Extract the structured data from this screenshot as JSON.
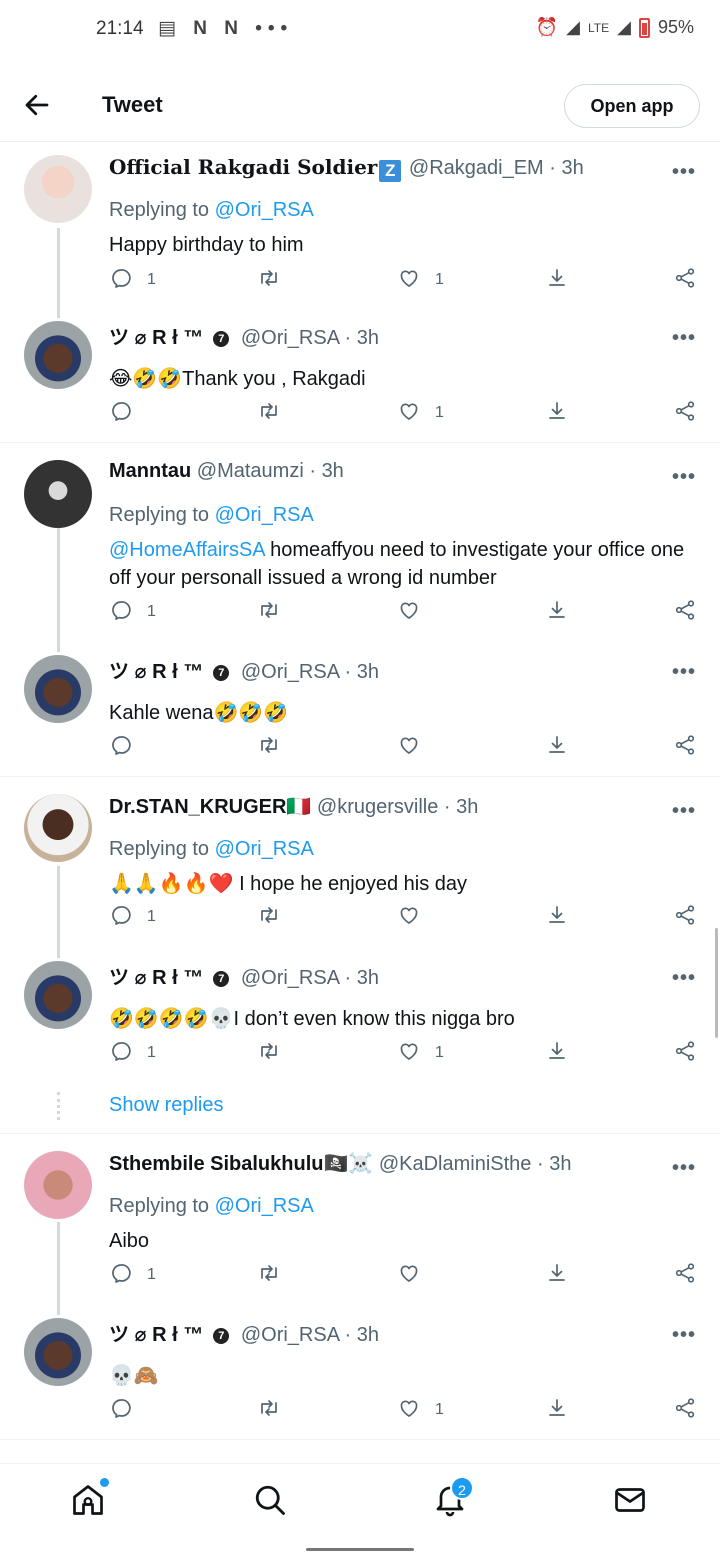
{
  "status_bar": {
    "time": "21:14",
    "notif_icons": "N N",
    "more": "•••",
    "network": "LTE",
    "battery": "95%"
  },
  "header": {
    "title": "Tweet",
    "open_app": "Open app"
  },
  "replying_label": "Replying to",
  "tweets": [
    {
      "name": "Official Rakgadi Soldier",
      "badge": "Z",
      "handle": "@Rakgadi_EM",
      "time": "3h",
      "replying_to": "@Ori_RSA",
      "text": "Happy birthday to him",
      "replies": "1",
      "retweets": "",
      "likes": "1"
    },
    {
      "name": "ツ ⌀ R ł ™",
      "badge": "7",
      "handle": "@Ori_RSA",
      "time": "3h",
      "replying_to": "",
      "text": "😂🤣🤣Thank you , Rakgadi",
      "replies": "",
      "retweets": "",
      "likes": "1"
    },
    {
      "name": "Manntau",
      "badge": "",
      "handle": "@Mataumzi",
      "time": "3h",
      "replying_to": "@Ori_RSA",
      "mention": "@HomeAffairsSA",
      "text": " homeaffyou need to investigate your office one off your personall issued a wrong id number",
      "replies": "1",
      "retweets": "",
      "likes": ""
    },
    {
      "name": "ツ ⌀ R ł ™",
      "badge": "7",
      "handle": "@Ori_RSA",
      "time": "3h",
      "replying_to": "",
      "text": "Kahle wena🤣🤣🤣",
      "replies": "",
      "retweets": "",
      "likes": ""
    },
    {
      "name": "Dr.STAN_KRUGER🇮🇹",
      "badge": "",
      "handle": "@krugersville",
      "time": "3h",
      "replying_to": "@Ori_RSA",
      "text": "🙏🙏🔥🔥❤️ I hope he enjoyed his day",
      "replies": "1",
      "retweets": "",
      "likes": ""
    },
    {
      "name": "ツ ⌀ R ł ™",
      "badge": "7",
      "handle": "@Ori_RSA",
      "time": "3h",
      "replying_to": "",
      "text": "🤣🤣🤣🤣💀I don’t even know this nigga bro",
      "replies": "1",
      "retweets": "",
      "likes": "1"
    },
    {
      "name": "Sthembile Sibalukhulu🏴‍☠️☠️",
      "badge": "",
      "handle": "@KaDlaminiSthe",
      "time": "3h",
      "replying_to": "@Ori_RSA",
      "text": "Aibo",
      "replies": "1",
      "retweets": "",
      "likes": ""
    },
    {
      "name": "ツ ⌀ R ł ™",
      "badge": "7",
      "handle": "@Ori_RSA",
      "time": "3h",
      "replying_to": "",
      "text": "💀🙈",
      "replies": "",
      "retweets": "",
      "likes": "1"
    }
  ],
  "show_replies": "Show replies",
  "nav": {
    "notif_count": "2"
  },
  "colors": {
    "accent": "#1d9bf0",
    "muted": "#536471",
    "text": "#0f1419"
  }
}
